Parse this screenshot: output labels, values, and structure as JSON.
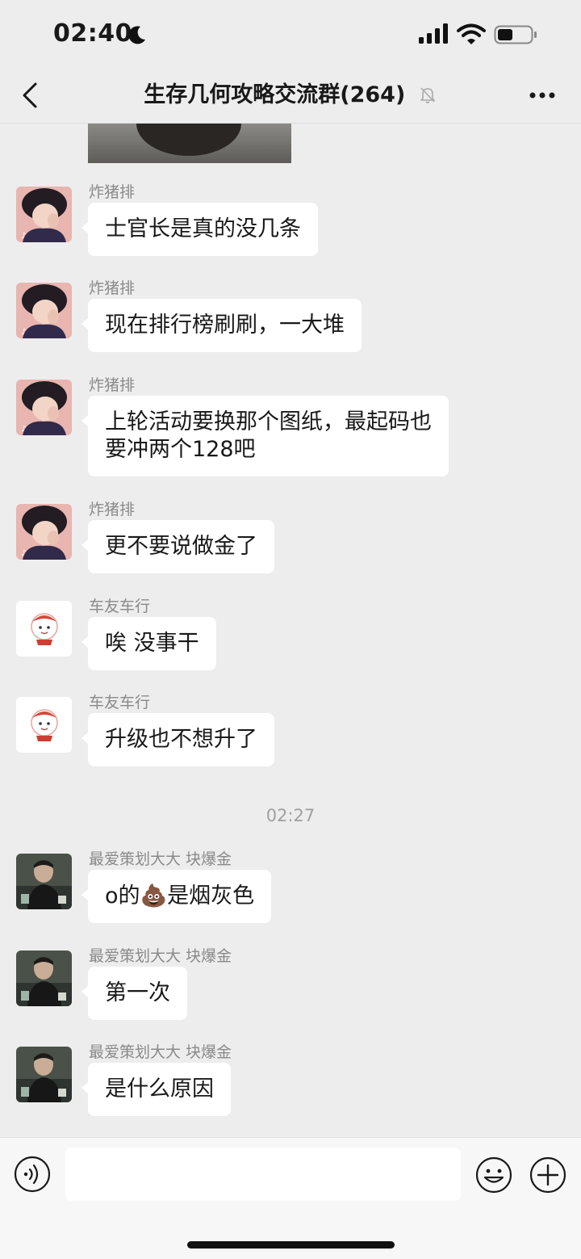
{
  "status_bar": {
    "time": "02:40"
  },
  "header": {
    "title": "生存几何攻略交流群(264)"
  },
  "messages": [
    {
      "sender": "炸猪排",
      "lines": [
        "士官长是真的没几条"
      ],
      "avatar": "hoodie-boy"
    },
    {
      "sender": "炸猪排",
      "lines": [
        "现在排行榜刷刷，一大堆"
      ],
      "avatar": "hoodie-boy"
    },
    {
      "sender": "炸猪排",
      "lines": [
        "上轮活动要换那个图纸，最起码也",
        "要冲两个128吧"
      ],
      "avatar": "hoodie-boy"
    },
    {
      "sender": "炸猪排",
      "lines": [
        "更不要说做金了"
      ],
      "avatar": "hoodie-boy"
    },
    {
      "sender": "车友车行",
      "lines": [
        "唉 没事干"
      ],
      "avatar": "cartoon-baby"
    },
    {
      "sender": "车友车行",
      "lines": [
        "升级也不想升了"
      ],
      "avatar": "cartoon-baby"
    },
    {
      "sender": "最爱策划大大 块爆金",
      "lines": [
        "o的💩是烟灰色"
      ],
      "avatar": "photo-man"
    },
    {
      "sender": "最爱策划大大 块爆金",
      "lines": [
        "第一次"
      ],
      "avatar": "photo-man"
    },
    {
      "sender": "最爱策划大大 块爆金",
      "lines": [
        "是什么原因"
      ],
      "avatar": "photo-man"
    }
  ],
  "time_separator": "02:27",
  "input": {
    "placeholder": ""
  },
  "icons": {
    "back": "chevron-left-icon",
    "mute": "bell-off-icon",
    "more": "more-dots-icon",
    "voice": "voice-icon",
    "emoji": "emoji-icon",
    "plus": "plus-icon"
  }
}
